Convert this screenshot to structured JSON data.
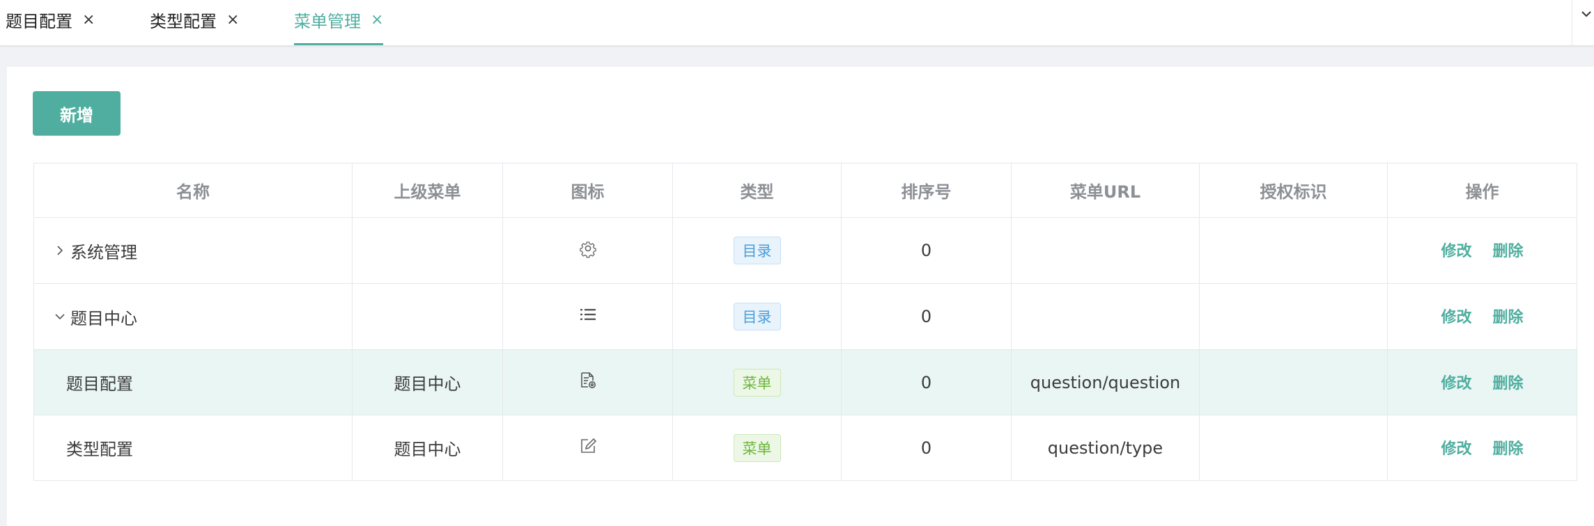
{
  "tabs": [
    {
      "label": "题目配置",
      "active": false
    },
    {
      "label": "类型配置",
      "active": false
    },
    {
      "label": "菜单管理",
      "active": true
    }
  ],
  "tab_close_glyph": "×",
  "toolbar": {
    "add_label": "新增"
  },
  "table": {
    "headers": [
      "名称",
      "上级菜单",
      "图标",
      "类型",
      "排序号",
      "菜单URL",
      "授权标识",
      "操作"
    ],
    "rows": [
      {
        "name": "系统管理",
        "expander": "collapsed",
        "parent": "",
        "icon": "gear-icon",
        "type": "目录",
        "order": "0",
        "url": "",
        "perm": "",
        "edit": "修改",
        "delete": "删除"
      },
      {
        "name": "题目中心",
        "expander": "expanded",
        "parent": "",
        "icon": "list-icon",
        "type": "目录",
        "order": "0",
        "url": "",
        "perm": "",
        "edit": "修改",
        "delete": "删除"
      },
      {
        "name": "题目配置",
        "expander": "none",
        "parent": "题目中心",
        "icon": "document-settings-icon",
        "type": "菜单",
        "order": "0",
        "url": "question/question",
        "perm": "",
        "edit": "修改",
        "delete": "删除"
      },
      {
        "name": "类型配置",
        "expander": "none",
        "parent": "题目中心",
        "icon": "edit-icon",
        "type": "菜单",
        "order": "0",
        "url": "question/type",
        "perm": "",
        "edit": "修改",
        "delete": "删除"
      }
    ]
  },
  "colors": {
    "accent": "#4fae9f",
    "tag_directory": "#4a9ed8",
    "tag_menu": "#6cb73e",
    "row_highlight": "#eaf6f4"
  }
}
